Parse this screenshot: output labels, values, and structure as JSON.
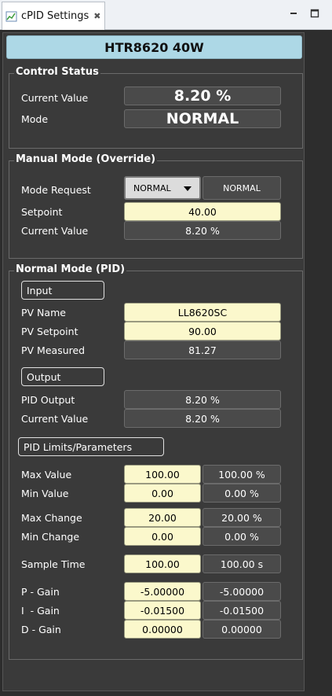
{
  "tab": {
    "label": "cPID Settings"
  },
  "header": {
    "title": "HTR8620 40W"
  },
  "control_status": {
    "title": "Control Status",
    "current_value_label": "Current Value",
    "current_value": "8.20 %",
    "mode_label": "Mode",
    "mode": "NORMAL"
  },
  "manual_mode": {
    "title": "Manual Mode (Override)",
    "mode_request_label": "Mode Request",
    "mode_request_selected": "NORMAL",
    "mode_request_readback": "NORMAL",
    "setpoint_label": "Setpoint",
    "setpoint": "40.00",
    "current_value_label": "Current Value",
    "current_value": "8.20 %"
  },
  "normal_mode": {
    "title": "Normal Mode (PID)",
    "input_header": "Input",
    "pv_name_label": "PV Name",
    "pv_name": "LL8620SC",
    "pv_setpoint_label": "PV Setpoint",
    "pv_setpoint": "90.00",
    "pv_measured_label": "PV Measured",
    "pv_measured": "81.27",
    "output_header": "Output",
    "pid_output_label": "PID Output",
    "pid_output": "8.20 %",
    "current_value_label": "Current Value",
    "current_value": "8.20 %",
    "limits_header": "PID Limits/Parameters",
    "max_value_label": "Max Value",
    "max_value": "100.00",
    "max_value_rb": "100.00 %",
    "min_value_label": "Min Value",
    "min_value": "0.00",
    "min_value_rb": "0.00 %",
    "max_change_label": "Max Change",
    "max_change": "20.00",
    "max_change_rb": "20.00 %",
    "min_change_label": "Min Change",
    "min_change": "0.00",
    "min_change_rb": "0.00 %",
    "sample_time_label": "Sample Time",
    "sample_time": "100.00",
    "sample_time_rb": "100.00 s",
    "p_gain_label": "P - Gain",
    "p_gain": "-5.00000",
    "p_gain_rb": "-5.00000",
    "i_gain_label": "I  - Gain",
    "i_gain": "-0.01500",
    "i_gain_rb": "-0.01500",
    "d_gain_label": "D - Gain",
    "d_gain": "0.00000",
    "d_gain_rb": "0.00000"
  }
}
